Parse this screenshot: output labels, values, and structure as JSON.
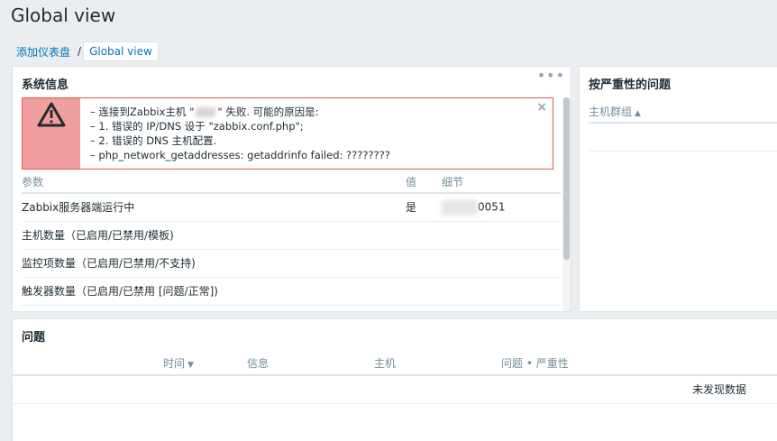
{
  "page": {
    "title": "Global view"
  },
  "breadcrumb": {
    "parent": "添加仪表盘",
    "separator": "/",
    "current": "Global view"
  },
  "system_info": {
    "title": "系统信息",
    "menu": "•••",
    "message": {
      "lines": [
        {
          "pre": "连接到Zabbix主机 \"",
          "post": "\" 失败. 可能的原因是:"
        },
        {
          "text": "1. 错误的 IP/DNS 设于 \"zabbix.conf.php\";"
        },
        {
          "text": "2. 错误的 DNS 主机配置."
        },
        {
          "text": "php_network_getaddresses: getaddrinfo failed: ????????"
        }
      ],
      "close": "×"
    },
    "columns": {
      "param": "参数",
      "value": "值",
      "details": "细节"
    },
    "rows": [
      {
        "param": "Zabbix服务器端运行中",
        "value": "是",
        "details": "0051"
      },
      {
        "param": "主机数量（已启用/已禁用/模板)",
        "value": "",
        "details": ""
      },
      {
        "param": "监控项数量（已启用/已禁用/不支持)",
        "value": "",
        "details": ""
      },
      {
        "param": "触发器数量（已启用/已禁用 [问题/正常])",
        "value": "",
        "details": ""
      }
    ]
  },
  "severity": {
    "title": "按严重性的问题",
    "column_host_group": "主机群组",
    "sort_indicator": "▲"
  },
  "problems": {
    "title": "问题",
    "columns": {
      "time": "时间",
      "info": "信息",
      "host": "主机",
      "problem_severity": "问题 • 严重性"
    },
    "sort_indicator": "▼",
    "no_data": "未发现数据"
  },
  "colors": {
    "accent_link": "#0275b8",
    "error_border": "#e45959",
    "error_icon_bg": "#f09e9e",
    "status_green": "#429e47"
  }
}
